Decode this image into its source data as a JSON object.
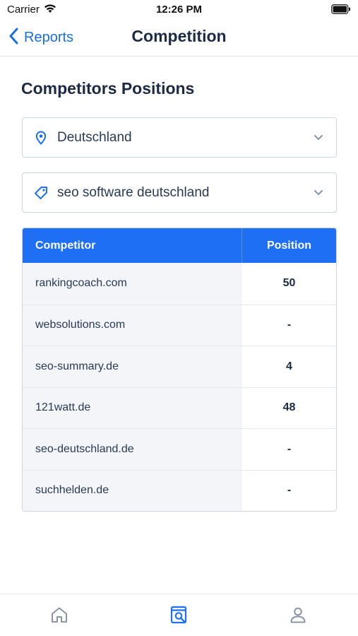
{
  "status_bar": {
    "carrier": "Carrier",
    "time": "12:26 PM",
    "icons": [
      "wifi-icon",
      "battery-icon"
    ]
  },
  "nav": {
    "back_label": "Reports",
    "title": "Competition"
  },
  "section_title": "Competitors Positions",
  "location_select": {
    "icon": "location-pin-icon",
    "value": "Deutschland"
  },
  "keyword_select": {
    "icon": "tag-icon",
    "value": "seo software deutschland"
  },
  "table": {
    "headers": {
      "competitor": "Competitor",
      "position": "Position"
    },
    "rows": [
      {
        "competitor": "rankingcoach.com",
        "position": "50"
      },
      {
        "competitor": "websolutions.com",
        "position": "-"
      },
      {
        "competitor": "seo-summary.de",
        "position": "4"
      },
      {
        "competitor": "121watt.de",
        "position": "48"
      },
      {
        "competitor": "seo-deutschland.de",
        "position": "-"
      },
      {
        "competitor": "suchhelden.de",
        "position": "-"
      }
    ]
  },
  "tab_bar": {
    "tabs": [
      "home-icon",
      "search-report-icon",
      "profile-icon"
    ],
    "active": "search-report-icon"
  },
  "colors": {
    "accent": "#1f6ff5",
    "link": "#1a6fe0",
    "text": "#1c2a44",
    "row_bg": "#f3f5f8"
  }
}
